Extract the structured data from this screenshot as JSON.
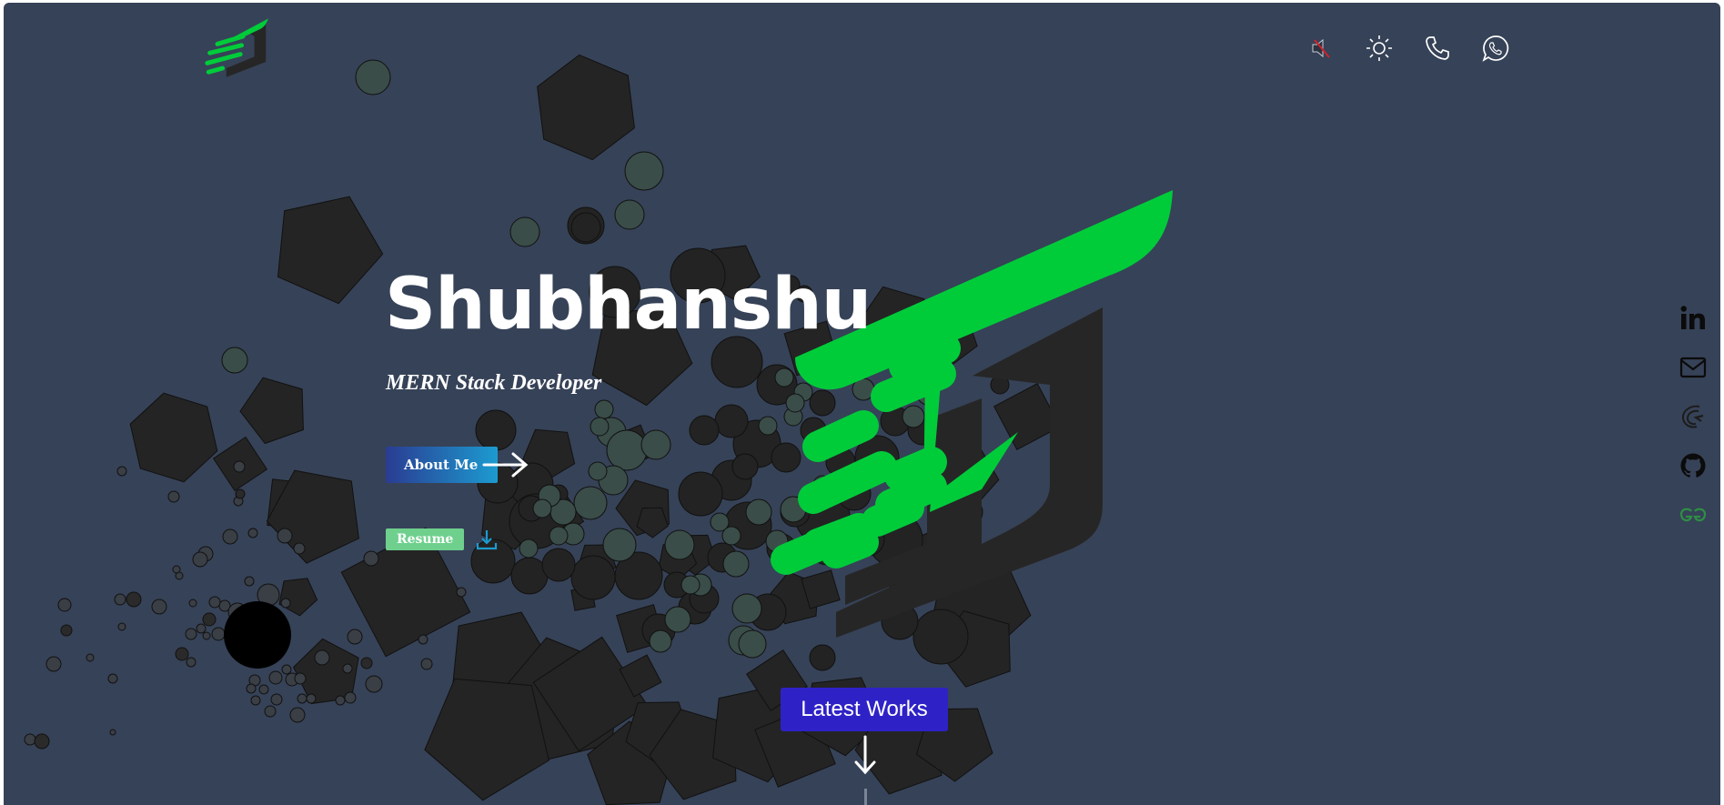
{
  "hero": {
    "name": "Shubhanshu",
    "role": "MERN Stack Developer"
  },
  "buttons": {
    "about_label": "About Me",
    "resume_label": "Resume",
    "latest_works_label": "Latest Works"
  },
  "header": {
    "icons": [
      "mute-icon",
      "sun-icon",
      "phone-icon",
      "whatsapp-icon"
    ]
  },
  "social": {
    "icons": [
      "linkedin-icon",
      "mail-icon",
      "codechef-icon",
      "github-icon",
      "geeksforgeeks-icon"
    ]
  },
  "colors": {
    "background": "#364257",
    "brand_green": "#00cc3a",
    "logo_dark": "#262626",
    "about_gradient_start": "#2a3c92",
    "about_gradient_end": "#1c9bd0",
    "resume_green": "#6fd08e",
    "works_blue": "#2e22c7"
  }
}
